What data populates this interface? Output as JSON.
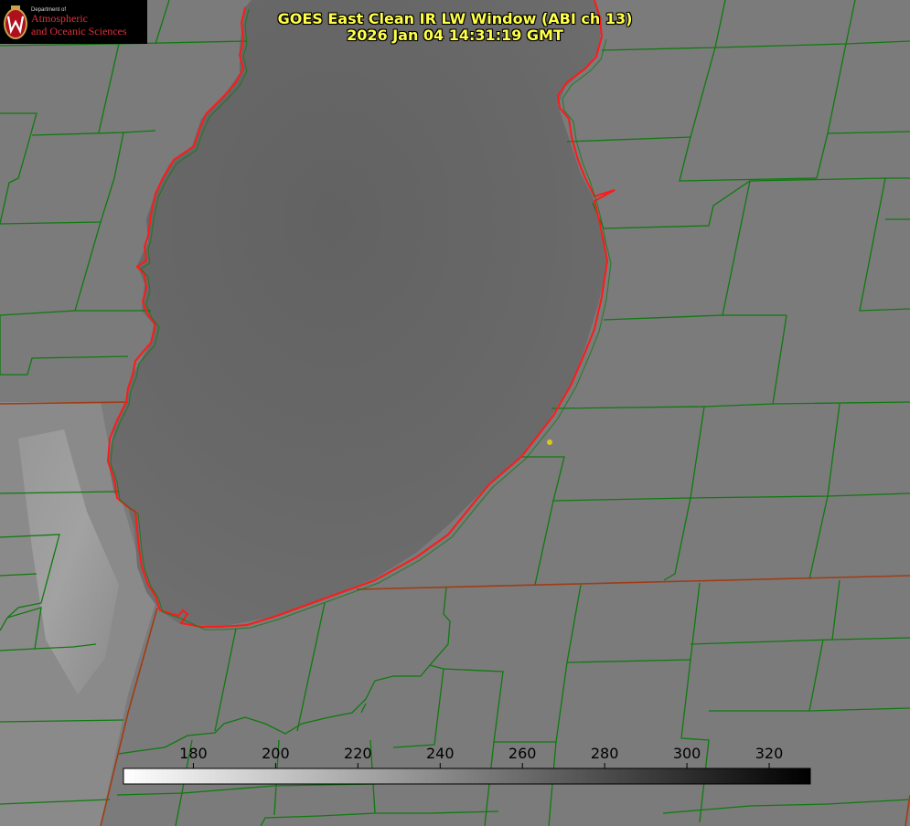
{
  "header": {
    "title_line1": "GOES East Clean IR LW Window (ABI ch 13)",
    "title_line2": "2026 Jan 04 14:31:19 GMT"
  },
  "logo": {
    "department": "Department of",
    "line1": "Atmospheric",
    "line2": "and Oceanic Sciences"
  },
  "colorbar": {
    "ticks": [
      "180",
      "200",
      "220",
      "240",
      "260",
      "280",
      "300",
      "320"
    ],
    "min": 163,
    "max": 330
  },
  "colors": {
    "county_lines": "#0f7a0f",
    "state_lines": "#a03c14",
    "shoreline": "#ff1a1a",
    "title_text": "#ffff4a",
    "marker": "#d8c81e"
  }
}
